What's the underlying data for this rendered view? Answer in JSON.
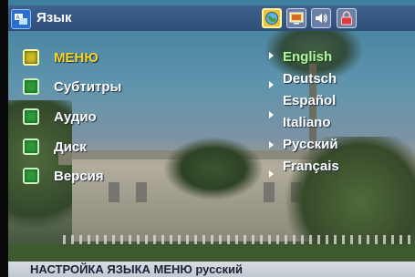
{
  "header": {
    "title": "Язык",
    "tabs": [
      {
        "icon": "language-globe-icon",
        "active": true
      },
      {
        "icon": "display-icon",
        "active": false
      },
      {
        "icon": "audio-speaker-icon",
        "active": false
      },
      {
        "icon": "lock-icon",
        "active": false
      }
    ]
  },
  "menu": {
    "items": [
      {
        "label": "МЕНЮ",
        "active": true
      },
      {
        "label": "Субтитры",
        "active": false
      },
      {
        "label": "Аудио",
        "active": false
      },
      {
        "label": "Диск",
        "active": false
      },
      {
        "label": "Версия",
        "active": false
      }
    ]
  },
  "languages": {
    "items": [
      {
        "label": "English",
        "selected": true
      },
      {
        "label": "Deutsch",
        "selected": false
      },
      {
        "label": "Español",
        "selected": false
      },
      {
        "label": "Italiano",
        "selected": false
      },
      {
        "label": "Русский",
        "selected": false
      },
      {
        "label": "Français",
        "selected": false
      }
    ]
  },
  "status": {
    "text": "НАСТРОЙКА ЯЗЫКА МЕНЮ русский"
  },
  "colors": {
    "highlight": "#f5d525",
    "bullet_green": "#2f9a3b",
    "topbar": "#2d4a74",
    "statusbar": "#c2c8d0"
  }
}
